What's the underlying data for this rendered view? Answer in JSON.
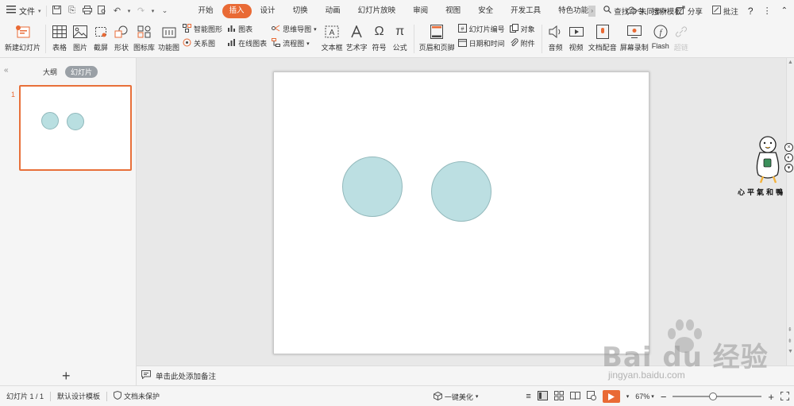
{
  "menubar": {
    "file_label": "文件",
    "tabs": [
      {
        "label": "开始",
        "active": false
      },
      {
        "label": "插入",
        "active": true
      },
      {
        "label": "设计",
        "active": false
      },
      {
        "label": "切换",
        "active": false
      },
      {
        "label": "动画",
        "active": false
      },
      {
        "label": "幻灯片放映",
        "active": false
      },
      {
        "label": "审阅",
        "active": false
      },
      {
        "label": "视图",
        "active": false
      },
      {
        "label": "安全",
        "active": false
      },
      {
        "label": "开发工具",
        "active": false
      },
      {
        "label": "特色功能",
        "active": false
      }
    ],
    "search_label": "查找命令、搜索模板",
    "sync_label": "未同步",
    "share_label": "分享",
    "comment_label": "批注"
  },
  "ribbon": {
    "new_slide": "新建幻灯片",
    "table": "表格",
    "picture": "图片",
    "screenshot": "截屏",
    "shape": "形状",
    "icon_library": "图标库",
    "function_chart": "功能图",
    "smart_art": "智能图形",
    "chart": "图表",
    "relation_chart": "关系图",
    "online_chart": "在线图表",
    "mind_map": "思维导图",
    "flowchart": "流程图",
    "textbox": "文本框",
    "art_text": "艺术字",
    "symbol": "符号",
    "formula": "公式",
    "header_footer": "页眉和页脚",
    "slide_number": "幻灯片编号",
    "object": "对象",
    "date_time": "日期和时间",
    "attachment": "附件",
    "audio": "音频",
    "video": "视频",
    "doc_voice": "文档配音",
    "screen_record": "屏幕录制",
    "flash": "Flash",
    "superlink": "超链"
  },
  "leftpanel": {
    "outline_tab": "大纲",
    "slides_tab": "幻灯片",
    "slide_number": "1"
  },
  "notes": {
    "placeholder": "单击此处添加备注"
  },
  "mascot": {
    "caption": "心平氣和鴨"
  },
  "statusbar": {
    "slide_info": "幻灯片 1 / 1",
    "template": "默认设计模板",
    "protection": "文档未保护",
    "beautify": "一键美化",
    "zoom": "67%",
    "zoom_fraction": 0.45
  },
  "watermark": {
    "brand": "Bai du 经验",
    "url": "jingyan.baidu.com"
  },
  "colors": {
    "accent": "#e96a35",
    "shape_fill": "#bcdfe2",
    "shape_stroke": "#93b9bc"
  }
}
